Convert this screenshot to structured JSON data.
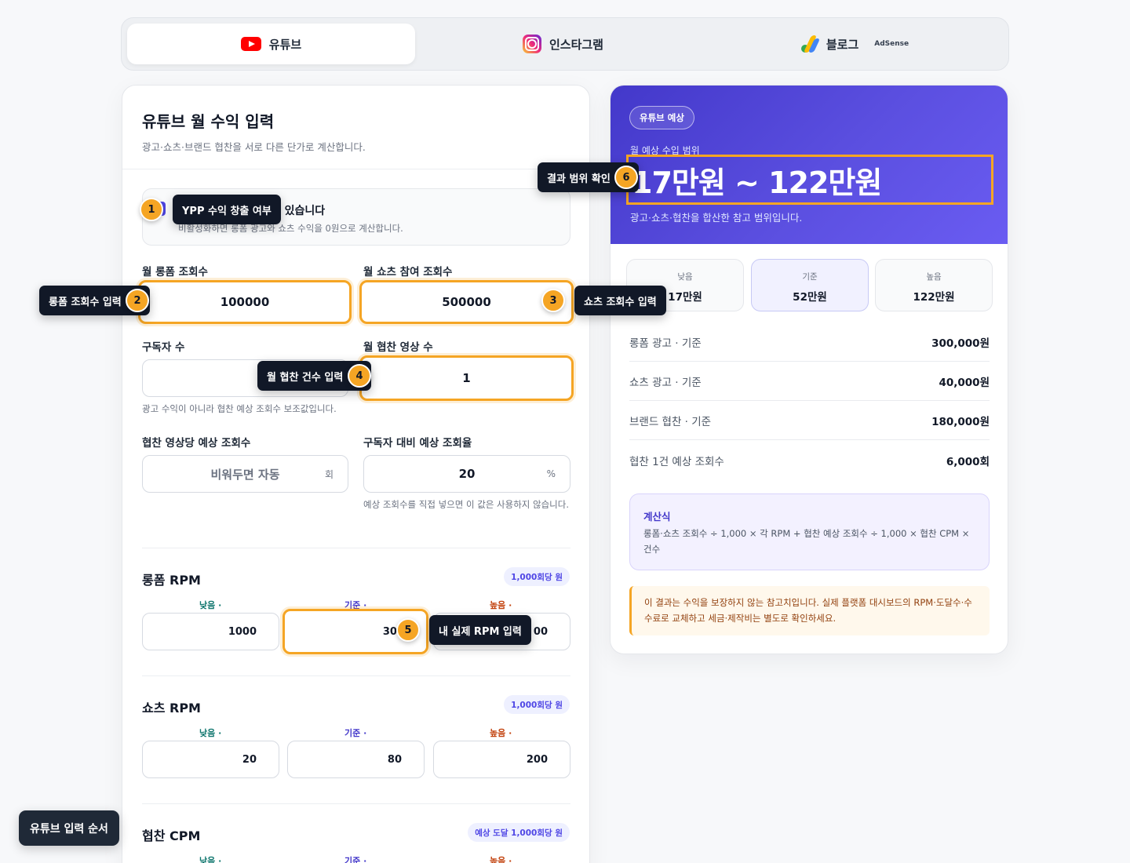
{
  "tabs": [
    {
      "label": "유튜브",
      "icon": "youtube-icon",
      "active": true
    },
    {
      "label": "인스타그램",
      "icon": "instagram-icon",
      "active": false
    },
    {
      "label": "블로그",
      "icon": "adsense-icon",
      "badge": "AdSense",
      "active": false
    }
  ],
  "input": {
    "title": "유튜브 월 수익 입력",
    "subtitle": "광고·쇼츠·브랜드 협찬을 서로 다른 단가로 계산합니다.",
    "ypp": {
      "label": "되어 있습니다",
      "help": "비활성화하면 롱폼 광고와 쇼츠 수익을 0원으로 계산합니다.",
      "checked": true
    },
    "longform_views": {
      "label": "월 롱폼 조회수",
      "value": "100000"
    },
    "shorts_views": {
      "label": "월 쇼츠 참여 조회수",
      "value": "500000"
    },
    "subscribers": {
      "label": "구독자 수",
      "value": "",
      "hint": "광고 수익이 아니라 협찬 예상 조회수 보조값입니다."
    },
    "sponsor_videos": {
      "label": "월 협찬 영상 수",
      "value": "1"
    },
    "sponsor_views": {
      "label": "협찬 영상당 예상 조회수",
      "placeholder": "비워두면 자동",
      "unit": "회"
    },
    "view_ratio": {
      "label": "구독자 대비 예상 조회율",
      "value": "20",
      "unit": "%",
      "hint": "예상 조회수를 직접 넣으면 이 값은 사용하지 않습니다."
    },
    "longform_rpm": {
      "title": "롱폼 RPM",
      "pill": "1,000회당 원",
      "low_label": "낮음 ·",
      "base_label": "기준 ·",
      "high_label": "높음 ·",
      "low": "1000",
      "base": "300",
      "high": "00"
    },
    "shorts_rpm": {
      "title": "쇼츠 RPM",
      "pill": "1,000회당 원",
      "low_label": "낮음 ·",
      "base_label": "기준 ·",
      "high_label": "높음 ·",
      "low": "20",
      "base": "80",
      "high": "200"
    },
    "sponsor_cpm": {
      "title": "협찬 CPM",
      "pill": "예상 도달 1,000회당 원",
      "low_label": "낮음 ·",
      "base_label": "기준 ·",
      "high_label": "높음 ·"
    }
  },
  "result": {
    "badge": "유튜브 예상",
    "range_label": "월 예상 수입 범위",
    "range": "17만원 ~ 122만원",
    "note": "광고·쇼츠·협찬을 합산한 참고 범위입니다.",
    "scenarios": [
      {
        "name": "낮음",
        "value": "17만원"
      },
      {
        "name": "기준",
        "value": "52만원"
      },
      {
        "name": "높음",
        "value": "122만원"
      }
    ],
    "rows": [
      {
        "name": "롱폼 광고 · 기준",
        "value": "300,000원"
      },
      {
        "name": "쇼츠 광고 · 기준",
        "value": "40,000원"
      },
      {
        "name": "브랜드 협찬 · 기준",
        "value": "180,000원"
      },
      {
        "name": "협찬 1건 예상 조회수",
        "value": "6,000회"
      }
    ],
    "formula_title": "계산식",
    "formula_text": "롱폼·쇼츠 조회수 ÷ 1,000 × 각 RPM + 협찬 예상 조회수 ÷ 1,000 × 협찬 CPM × 건수",
    "warning": "이 결과는 수익을 보장하지 않는 참고치입니다. 실제 플랫폼 대시보드의 RPM·도달수·수수료로 교체하고 세금·제작비는 별도로 확인하세요."
  },
  "tour": {
    "steps": [
      {
        "n": "1",
        "text": "YPP 수익 창출 여부"
      },
      {
        "n": "2",
        "text": "롱폼 조회수 입력"
      },
      {
        "n": "3",
        "text": "쇼츠 조회수 입력"
      },
      {
        "n": "4",
        "text": "월 협찬 건수 입력"
      },
      {
        "n": "5",
        "text": "내 실제 RPM 입력"
      },
      {
        "n": "6",
        "text": "결과 범위 확인"
      }
    ],
    "button": "유튜브 입력 순서"
  }
}
